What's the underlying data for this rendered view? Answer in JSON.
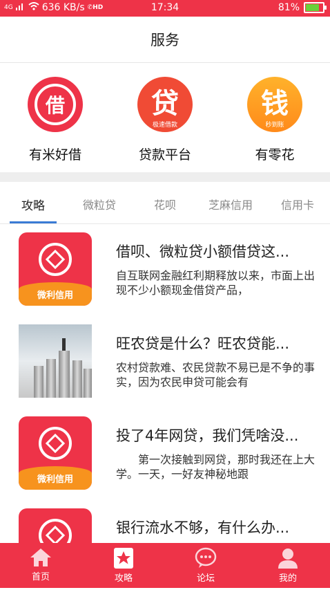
{
  "status": {
    "network": "4G",
    "speed": "636 KB/s",
    "call_hd": "HD",
    "time": "17:34",
    "battery": "81%",
    "battery_level": 0.81
  },
  "header": {
    "title": "服务"
  },
  "services": [
    {
      "label": "有米好借",
      "glyph": "借"
    },
    {
      "label": "贷款平台",
      "glyph": "贷",
      "tag": "极速借款"
    },
    {
      "label": "有零花",
      "glyph": "钱",
      "tag": "秒到账"
    }
  ],
  "tabs": [
    {
      "label": "攻略",
      "active": true
    },
    {
      "label": "微粒贷"
    },
    {
      "label": "花呗"
    },
    {
      "label": "芝麻信用"
    },
    {
      "label": "信用卡"
    }
  ],
  "articles": [
    {
      "title": "借呗、微粒贷小额借贷这...",
      "desc": "自互联网金融红利期释放以来，市面上出现不少小额现金借贷产品，",
      "thumb_label": "微利信用"
    },
    {
      "title": "旺农贷是什么？旺农贷能...",
      "desc": "农村贷款难、农民贷款不易已是不争的事实，因为农民申贷可能会有"
    },
    {
      "title": "投了4年网贷，我们凭啥没...",
      "desc": "　　第一次接触到网贷，那时我还在上大学。一天，一好友神秘地跟",
      "thumb_label": "微利信用"
    },
    {
      "title": "银行流水不够，有什么办...",
      "desc": ""
    }
  ],
  "tabbar": [
    {
      "label": "首页",
      "icon": "home-icon"
    },
    {
      "label": "攻略",
      "icon": "bookmark-star-icon"
    },
    {
      "label": "论坛",
      "icon": "chat-bubble-icon"
    },
    {
      "label": "我的",
      "icon": "user-icon"
    }
  ],
  "colors": {
    "brand": "#ee3348",
    "orange": "#f7931e",
    "tab_underline": "#3a7bd5"
  }
}
